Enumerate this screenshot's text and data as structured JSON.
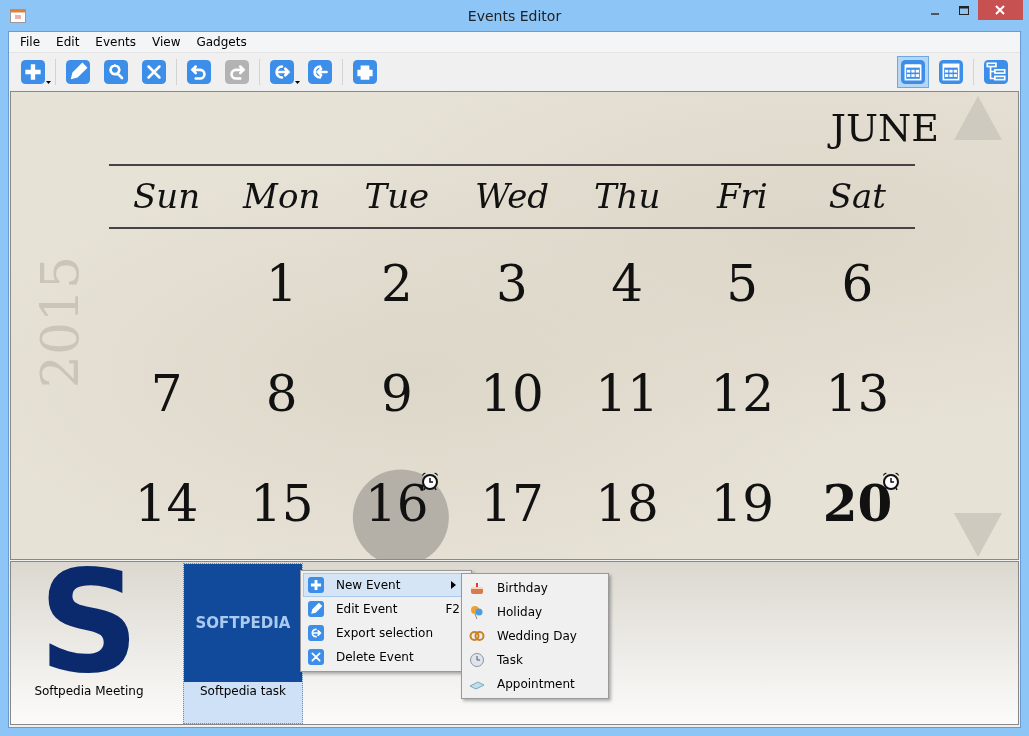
{
  "window": {
    "title": "Events Editor"
  },
  "menu": [
    "File",
    "Edit",
    "Events",
    "View",
    "Gadgets"
  ],
  "toolbar": [
    [
      {
        "kind": "add",
        "dropdown": true,
        "disabled": false
      }
    ],
    [
      {
        "kind": "edit",
        "dropdown": false,
        "disabled": false
      },
      {
        "kind": "search",
        "dropdown": false,
        "disabled": false
      },
      {
        "kind": "delete",
        "dropdown": false,
        "disabled": false
      }
    ],
    [
      {
        "kind": "undo",
        "dropdown": false,
        "disabled": false
      },
      {
        "kind": "redo",
        "dropdown": false,
        "disabled": true
      }
    ],
    [
      {
        "kind": "export",
        "dropdown": true,
        "disabled": false
      },
      {
        "kind": "import",
        "dropdown": false,
        "disabled": false
      }
    ],
    [
      {
        "kind": "print",
        "dropdown": false,
        "disabled": false
      }
    ]
  ],
  "view_buttons": [
    [
      {
        "kind": "month",
        "selected": true
      },
      {
        "kind": "year",
        "selected": false
      }
    ],
    [
      {
        "kind": "tree",
        "selected": false
      }
    ]
  ],
  "calendar": {
    "month": "JUNE",
    "year": "2015",
    "weekdays": [
      "Sun",
      "Mon",
      "Tue",
      "Wed",
      "Thu",
      "Fri",
      "Sat"
    ],
    "weeks": [
      [
        {
          "kind": "blank"
        },
        {
          "kind": "day",
          "day": "1",
          "selected": false,
          "alarm": false,
          "today": false
        },
        {
          "kind": "day",
          "day": "2",
          "selected": false,
          "alarm": false,
          "today": false
        },
        {
          "kind": "day",
          "day": "3",
          "selected": false,
          "alarm": false,
          "today": false
        },
        {
          "kind": "day",
          "day": "4",
          "selected": false,
          "alarm": false,
          "today": false
        },
        {
          "kind": "day",
          "day": "5",
          "selected": false,
          "alarm": false,
          "today": false
        },
        {
          "kind": "day",
          "day": "6",
          "selected": false,
          "alarm": false,
          "today": false
        }
      ],
      [
        {
          "kind": "day",
          "day": "7",
          "selected": false,
          "alarm": false,
          "today": false
        },
        {
          "kind": "day",
          "day": "8",
          "selected": false,
          "alarm": false,
          "today": false
        },
        {
          "kind": "day",
          "day": "9",
          "selected": false,
          "alarm": false,
          "today": false
        },
        {
          "kind": "day",
          "day": "10",
          "selected": false,
          "alarm": false,
          "today": false
        },
        {
          "kind": "day",
          "day": "11",
          "selected": false,
          "alarm": false,
          "today": false
        },
        {
          "kind": "day",
          "day": "12",
          "selected": false,
          "alarm": false,
          "today": false
        },
        {
          "kind": "day",
          "day": "13",
          "selected": false,
          "alarm": false,
          "today": false
        }
      ],
      [
        {
          "kind": "day",
          "day": "14",
          "selected": false,
          "alarm": false,
          "today": false
        },
        {
          "kind": "day",
          "day": "15",
          "selected": false,
          "alarm": false,
          "today": false
        },
        {
          "kind": "day",
          "day": "16",
          "selected": true,
          "alarm": true,
          "today": false
        },
        {
          "kind": "day",
          "day": "17",
          "selected": false,
          "alarm": false,
          "today": false
        },
        {
          "kind": "day",
          "day": "18",
          "selected": false,
          "alarm": false,
          "today": false
        },
        {
          "kind": "day",
          "day": "19",
          "selected": false,
          "alarm": false,
          "today": false
        },
        {
          "kind": "day",
          "day": "20",
          "selected": false,
          "alarm": true,
          "today": true
        }
      ]
    ]
  },
  "events": [
    {
      "label": "Softpedia Meeting",
      "logo_text": "S",
      "kind": "letter",
      "selected": false
    },
    {
      "label": "Softpedia task",
      "logo_text": "SOFTPEDIA",
      "kind": "wordmark",
      "selected": true
    }
  ],
  "context_menu": {
    "items": [
      {
        "label": "New Event",
        "kind": "add",
        "submenu": true,
        "highlighted": true
      },
      {
        "label": "Edit Event",
        "kind": "edit",
        "shortcut": "F2",
        "submenu": false,
        "highlighted": false
      },
      {
        "label": "Export selection",
        "kind": "export",
        "submenu": false,
        "highlighted": false
      },
      {
        "label": "Delete Event",
        "kind": "delete",
        "submenu": false,
        "highlighted": false
      }
    ],
    "submenu": [
      {
        "label": "Birthday",
        "kind": "cake"
      },
      {
        "label": "Holiday",
        "kind": "balloon"
      },
      {
        "label": "Wedding Day",
        "kind": "rings"
      },
      {
        "label": "Task",
        "kind": "clock"
      },
      {
        "label": "Appointment",
        "kind": "note"
      }
    ]
  }
}
